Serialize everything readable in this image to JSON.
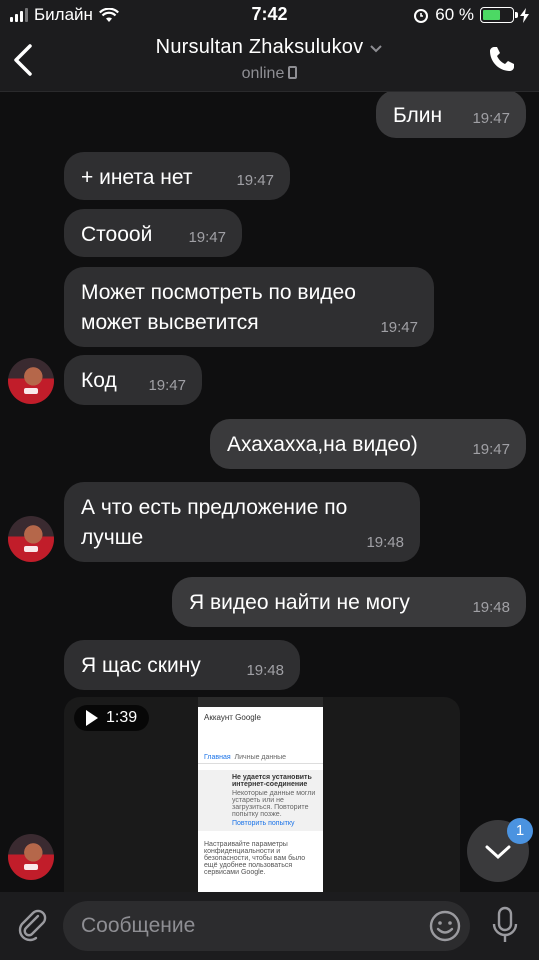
{
  "status_bar": {
    "carrier": "Билайн",
    "time": "7:42",
    "battery": "60 %",
    "battery_level": 0.6
  },
  "header": {
    "title": "Nursultan Zhaksulukov",
    "subtitle": "online"
  },
  "messages": [
    {
      "side": "out",
      "text": "Блин",
      "time": "19:47"
    },
    {
      "side": "in",
      "text": "+ инета нет",
      "time": "19:47"
    },
    {
      "side": "in",
      "text": "Стооой",
      "time": "19:47"
    },
    {
      "side": "in",
      "text": "Может посмотреть по видео\nможет высветится",
      "time": "19:47"
    },
    {
      "side": "in",
      "text": "Код",
      "time": "19:47"
    },
    {
      "side": "out",
      "text": "Ахахахха,на видео)",
      "time": "19:47"
    },
    {
      "side": "in",
      "text": "А что есть предложение по\nлучше",
      "time": "19:48"
    },
    {
      "side": "out",
      "text": "Я видео найти не могу",
      "time": "19:48"
    },
    {
      "side": "in",
      "text": "Я щас скину",
      "time": "19:48"
    }
  ],
  "video": {
    "duration": "1:39",
    "thumb_title": "Аккаунт Google",
    "thumb_tabs": [
      "Главная",
      "Личные данные"
    ],
    "thumb_error_title": "Не удается установить интернет-соединение",
    "thumb_error_body": "Некоторые данные могли устареть или не загрузиться. Повторите попытку позже.",
    "thumb_retry": "Повторить попытку",
    "thumb_footer": "Настраивайте параметры конфиденциальности и безопасности, чтобы вам было ещё удобнее пользоваться сервисами Google."
  },
  "scroll_badge": "1",
  "composer": {
    "placeholder": "Сообщение"
  },
  "colors": {
    "background": "#0f0f10",
    "bubble_in": "#2f2f31",
    "bubble_out": "#3a3a3c",
    "badge": "#4b93e0"
  }
}
